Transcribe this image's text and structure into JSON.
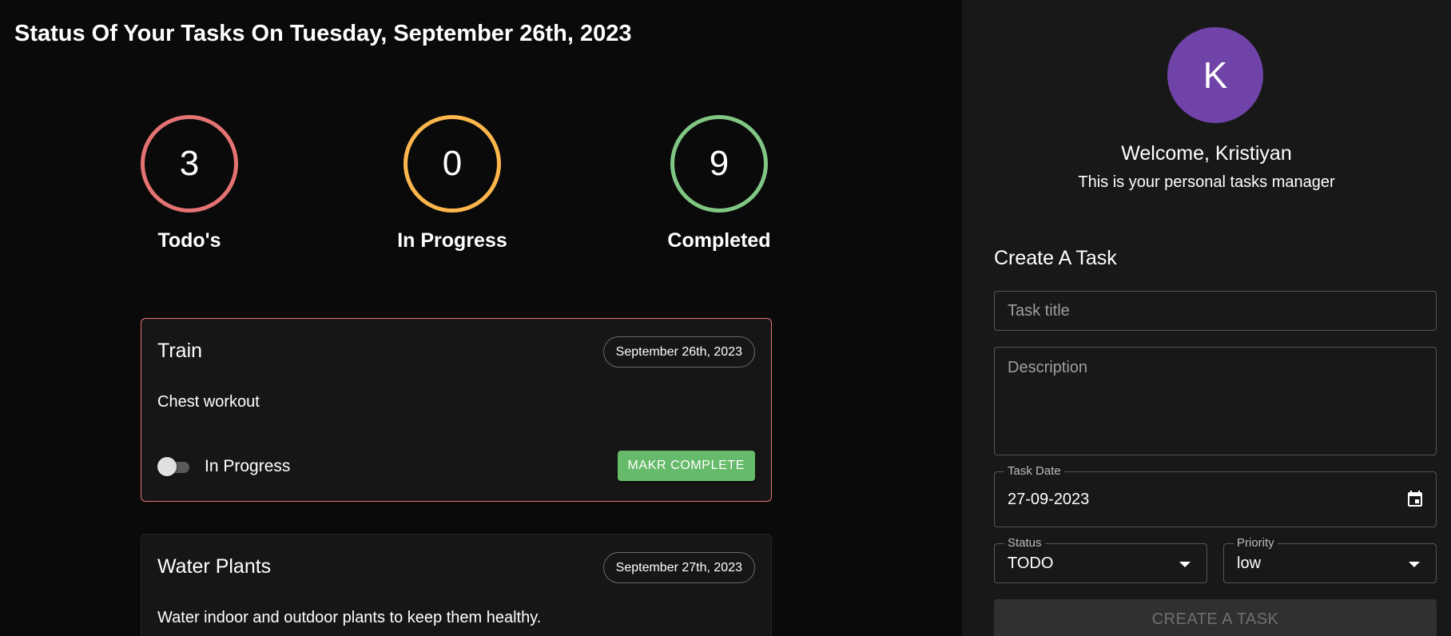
{
  "page": {
    "title": "Status Of Your Tasks On Tuesday, September 26th, 2023"
  },
  "stats": [
    {
      "count": "3",
      "label": "Todo's",
      "color": "#e57373"
    },
    {
      "count": "0",
      "label": "In Progress",
      "color": "#ffb74d"
    },
    {
      "count": "9",
      "label": "Completed",
      "color": "#81c784"
    }
  ],
  "tasks": [
    {
      "title": "Train",
      "date": "September 26th, 2023",
      "description": "Chest workout",
      "status_toggle_label": "In Progress",
      "status_toggle_on": false,
      "action_label": "MAKR COMPLETE"
    },
    {
      "title": "Water Plants",
      "date": "September 27th, 2023",
      "description": "Water indoor and outdoor plants to keep them healthy."
    }
  ],
  "sidebar": {
    "avatar_initial": "K",
    "avatar_color": "#7043a8",
    "welcome": "Welcome, Kristiyan",
    "subtitle": "This is your personal tasks manager",
    "form": {
      "heading": "Create A Task",
      "title_placeholder": "Task title",
      "description_placeholder": "Description",
      "date_label": "Task Date",
      "date_value": "27-09-2023",
      "date_icon": "calendar-icon",
      "status_label": "Status",
      "status_value": "TODO",
      "priority_label": "Priority",
      "priority_value": "low",
      "submit_label": "CREATE A TASK"
    }
  }
}
